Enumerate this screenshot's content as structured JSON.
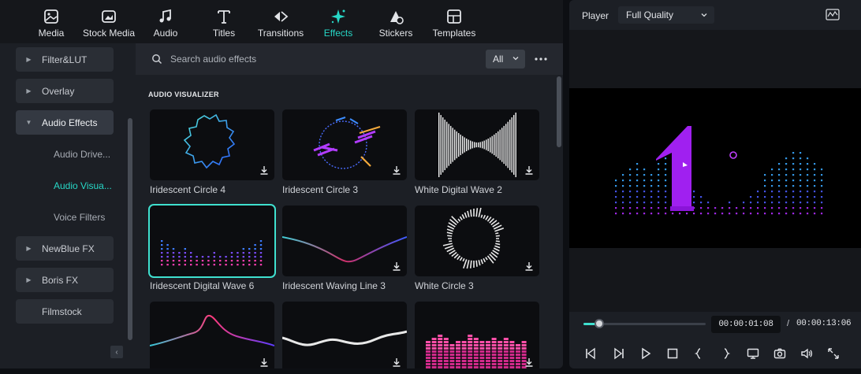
{
  "toolbar": {
    "items": [
      {
        "label": "Media",
        "icon": "media-icon"
      },
      {
        "label": "Stock Media",
        "icon": "stock-media-icon"
      },
      {
        "label": "Audio",
        "icon": "music-note-icon"
      },
      {
        "label": "Titles",
        "icon": "text-t-icon"
      },
      {
        "label": "Transitions",
        "icon": "transitions-icon"
      },
      {
        "label": "Effects",
        "icon": "sparkle-effects-icon",
        "active": true
      },
      {
        "label": "Stickers",
        "icon": "stickers-icon"
      },
      {
        "label": "Templates",
        "icon": "templates-icon"
      }
    ]
  },
  "sidebar": {
    "categories": [
      {
        "label": "Filter&LUT"
      },
      {
        "label": "Overlay"
      },
      {
        "label": "Audio Effects",
        "open": true
      },
      {
        "label": "NewBlue FX"
      },
      {
        "label": "Boris FX"
      },
      {
        "label": "Filmstock"
      }
    ],
    "subitems": [
      {
        "label": "Audio Drive..."
      },
      {
        "label": "Audio Visua...",
        "active": true
      },
      {
        "label": "Voice Filters"
      }
    ],
    "collapse_glyph": "‹"
  },
  "search": {
    "placeholder": "Search audio effects",
    "filter_value": "All"
  },
  "section": {
    "title": "AUDIO VISUALIZER"
  },
  "cards": [
    {
      "label": "Iridescent Circle 4"
    },
    {
      "label": "Iridescent Circle 3"
    },
    {
      "label": "White  Digital Wave 2"
    },
    {
      "label": "Iridescent Digital Wave 6",
      "selected": true
    },
    {
      "label": "Iridescent Waving Line 3"
    },
    {
      "label": "White Circle 3"
    },
    {
      "label": ""
    },
    {
      "label": ""
    },
    {
      "label": ""
    }
  ],
  "player": {
    "title": "Player",
    "quality": "Full Quality",
    "current_time": "00:00:01:08",
    "separator": "/",
    "total_time": "00:00:13:06",
    "progress_fraction": 0.13
  },
  "colors": {
    "accent": "#27d8c7",
    "purple": "#a020f0"
  }
}
